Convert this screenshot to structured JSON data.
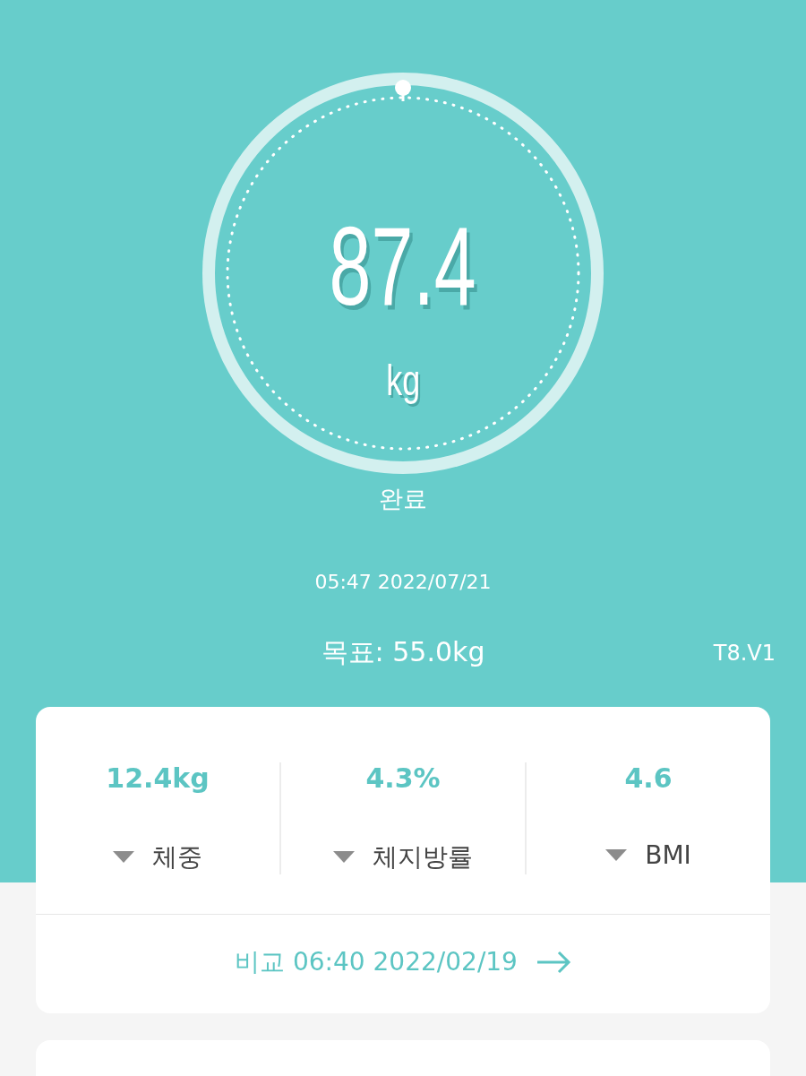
{
  "weight": {
    "value": "87.4",
    "unit": "kg",
    "status": "완료"
  },
  "timestamp": "05:47 2022/07/21",
  "goal": "목표: 55.0kg",
  "version": "T8.V1",
  "metrics": [
    {
      "value": "12.4kg",
      "label": "체중"
    },
    {
      "value": "4.3%",
      "label": "체지방률"
    },
    {
      "value": "4.6",
      "label": "BMI"
    }
  ],
  "compare": "비교 06:40 2022/02/19"
}
